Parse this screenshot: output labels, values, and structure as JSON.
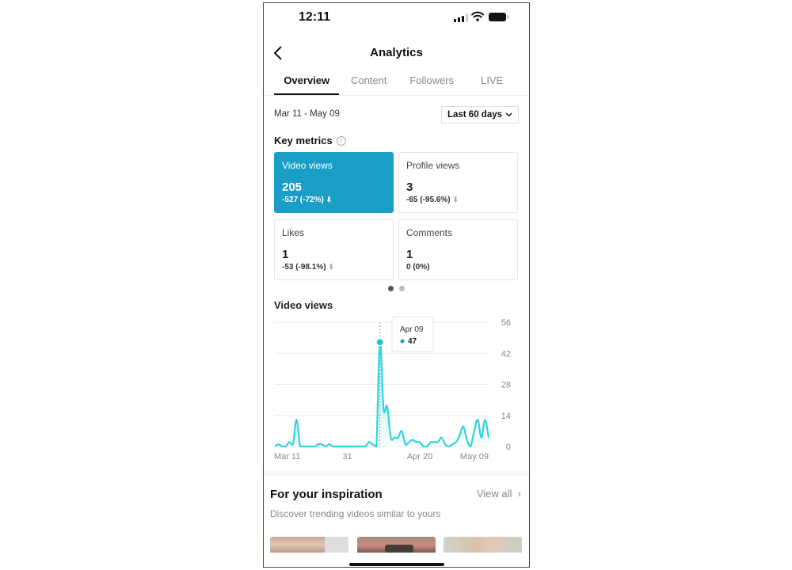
{
  "status_bar": {
    "time": "12:11",
    "icons": [
      "cellular-signal-icon",
      "wifi-icon",
      "battery-icon"
    ]
  },
  "header": {
    "title": "Analytics",
    "back_icon": "chevron-left-icon"
  },
  "tabs": [
    {
      "label": "Overview",
      "active": true
    },
    {
      "label": "Content",
      "active": false
    },
    {
      "label": "Followers",
      "active": false
    },
    {
      "label": "LIVE",
      "active": false
    }
  ],
  "date_range": "Mar 11 - May 09",
  "period_select": {
    "value": "Last 60 days",
    "icon": "chevron-down-icon"
  },
  "key_metrics": {
    "title": "Key metrics",
    "info_icon": "info-icon",
    "cards": [
      {
        "label": "Video views",
        "value": "205",
        "change": "-527 (-72%)",
        "trend": "down",
        "active": true
      },
      {
        "label": "Profile views",
        "value": "3",
        "change": "-65 (-95.6%)",
        "trend": "down",
        "active": false
      },
      {
        "label": "Likes",
        "value": "1",
        "change": "-53 (-98.1%)",
        "trend": "down",
        "active": false
      },
      {
        "label": "Comments",
        "value": "1",
        "change": "0 (0%)",
        "trend": "none",
        "active": false
      }
    ],
    "page_dots": {
      "count": 2,
      "active_index": 0
    }
  },
  "video_views_chart": {
    "title": "Video views",
    "tooltip": {
      "date": "Apr 09",
      "value": "47"
    }
  },
  "chart_data": {
    "type": "area",
    "title": "Video views",
    "x_tick_labels": [
      "Mar 11",
      "31",
      "Apr 20",
      "May 09"
    ],
    "x_tick_indices": [
      0,
      20,
      40,
      59
    ],
    "y_ticks": [
      0,
      14,
      28,
      42,
      56
    ],
    "ylim": [
      0,
      56
    ],
    "y_axis_position": "right",
    "grid": true,
    "highlight": {
      "date": "Apr 09",
      "index": 29,
      "value": 47
    },
    "series": [
      {
        "name": "Video views",
        "color": "#2fd4e0",
        "values": [
          0,
          1,
          0,
          0,
          2,
          1,
          12,
          0,
          0,
          0,
          0,
          0,
          1,
          1,
          0,
          1,
          0,
          0,
          0,
          0,
          0,
          0,
          0,
          0,
          0,
          0,
          2,
          1,
          0,
          47,
          17,
          18,
          4,
          4,
          4,
          7,
          1,
          2,
          3,
          2,
          2,
          0,
          0,
          2,
          2,
          2,
          4,
          1,
          0,
          1,
          2,
          5,
          9,
          3,
          0,
          7,
          12,
          4,
          12,
          4
        ]
      }
    ]
  },
  "inspiration": {
    "title": "For your inspiration",
    "view_all": "View all",
    "subtitle": "Discover trending videos similar to yours",
    "thumbnails": [
      {
        "name": "inspiration-video-1"
      },
      {
        "name": "inspiration-video-2"
      },
      {
        "name": "inspiration-video-3"
      }
    ]
  }
}
